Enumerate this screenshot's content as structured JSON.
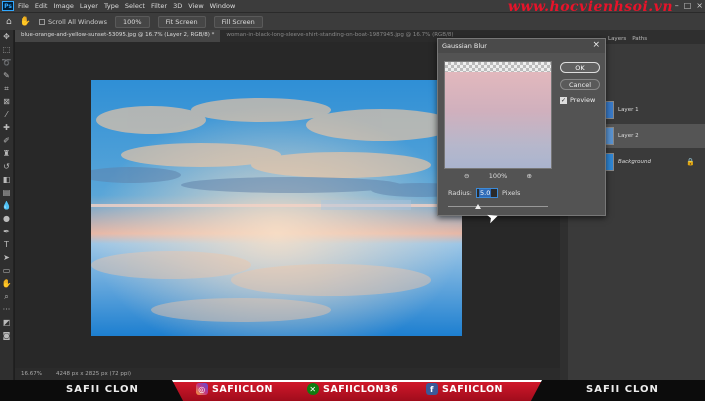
{
  "app": {
    "logo": "Ps",
    "menu": [
      "File",
      "Edit",
      "Image",
      "Layer",
      "Type",
      "Select",
      "Filter",
      "3D",
      "View",
      "Window"
    ],
    "watermark": "www.hocvienhsoi.vn"
  },
  "options_bar": {
    "scroll_all": "Scroll All Windows",
    "zoom": "100%",
    "fit_screen": "Fit Screen",
    "fill_screen": "Fill Screen"
  },
  "tabs": [
    {
      "label": "blue-orange-and-yellow-sunset-53095.jpg @ 16.7% (Layer 2, RGB/8) *"
    },
    {
      "label": "woman-in-black-long-sleeve-shirt-standing-on-boat-1987945.jpg @ 16.7% (RGB/8)"
    }
  ],
  "status": {
    "zoom": "16.67%",
    "size": "4248 px x 2825 px (72 ppi)"
  },
  "dialog": {
    "title": "Gaussian Blur",
    "ok": "OK",
    "cancel": "Cancel",
    "preview_label": "Preview",
    "zoom_level": "100%",
    "radius_label": "Radius:",
    "radius_value": "5.0",
    "unit": "Pixels",
    "slider_fraction": 0.3
  },
  "panel": {
    "tabs": [
      "Layers",
      "Paths"
    ],
    "layers": [
      {
        "name": "Layer 1"
      },
      {
        "name": "Layer 2"
      },
      {
        "name": "Background"
      }
    ]
  },
  "banner": {
    "left": "SAFII CLON",
    "right": "SAFII CLON",
    "instagram": "SAFIICLON",
    "xbox": "SAFIICLON36",
    "facebook": "SAFIICLON"
  }
}
